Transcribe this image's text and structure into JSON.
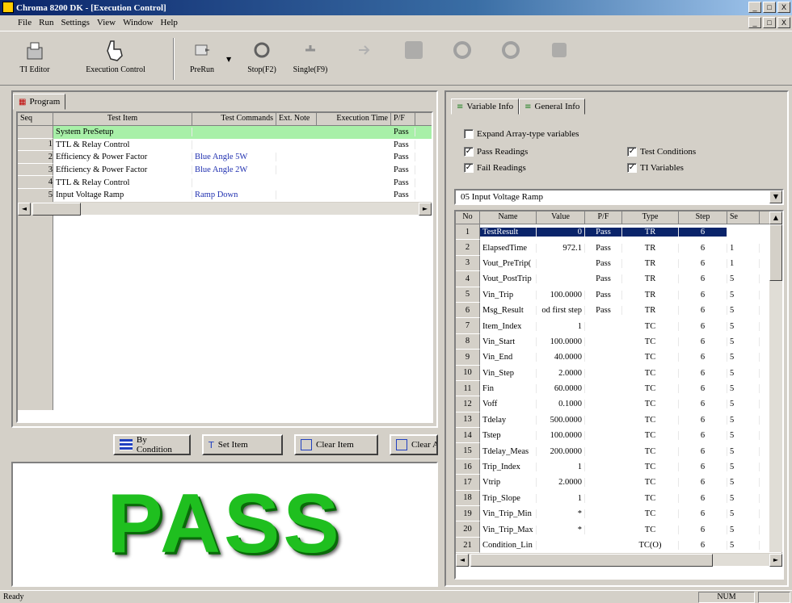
{
  "window": {
    "title": "Chroma 8200 DK - [Execution Control]",
    "controls": [
      "_",
      "□",
      "X"
    ],
    "mdi_controls": [
      "_",
      "□",
      "X"
    ]
  },
  "menu": [
    "File",
    "Run",
    "Settings",
    "View",
    "Window",
    "Help"
  ],
  "toolbar": {
    "ti_editor": "TI Editor",
    "execution_control": "Execution Control",
    "prerun": "PreRun",
    "stop": "Stop(F2)",
    "single": "Single(F9)"
  },
  "program_panel": {
    "tab": "Program",
    "columns": [
      "Seq",
      "Test Item",
      "Test Commands",
      "Ext. Note",
      "Execution Time",
      "P/F"
    ],
    "rows": [
      {
        "seq": "",
        "item": "System PreSetup",
        "cmd": "",
        "pf": "Pass"
      },
      {
        "seq": "1",
        "item": "TTL & Relay Control",
        "cmd": "",
        "pf": "Pass"
      },
      {
        "seq": "2",
        "item": "Efficiency & Power Factor",
        "cmd": "Blue Angle 5W",
        "pf": "Pass"
      },
      {
        "seq": "3",
        "item": "Efficiency & Power Factor",
        "cmd": "Blue Angle 2W",
        "pf": "Pass"
      },
      {
        "seq": "4",
        "item": "TTL & Relay Control",
        "cmd": "",
        "pf": "Pass"
      },
      {
        "seq": "5",
        "item": "Input Voltage Ramp",
        "cmd": "Ramp Down",
        "pf": "Pass"
      }
    ]
  },
  "buttons": {
    "by_condition": "By Condition",
    "set_item": "Set Item",
    "clear_item": "Clear Item",
    "clear_all": "Clear All"
  },
  "result": {
    "text": "PASS",
    "color": "#1fbf1f"
  },
  "variable_panel": {
    "tab_variable": "Variable Info",
    "tab_general": "General Info",
    "expand_array": "Expand Array-type variables",
    "pass_readings": "Pass Readings",
    "fail_readings": "Fail Readings",
    "test_conditions": "Test Conditions",
    "ti_variables": "TI Variables",
    "dropdown": "05 Input Voltage Ramp",
    "columns": [
      "No",
      "Name",
      "Value",
      "P/F",
      "Type",
      "Step",
      "Se"
    ],
    "rows": [
      {
        "no": "1",
        "name": "TestResult",
        "value": "0",
        "pf": "Pass",
        "type": "TR",
        "step": "6",
        "se": ""
      },
      {
        "no": "2",
        "name": "ElapsedTime",
        "value": "972.1",
        "pf": "Pass",
        "type": "TR",
        "step": "6",
        "se": "1"
      },
      {
        "no": "3",
        "name": "Vout_PreTrip(",
        "value": "",
        "pf": "Pass",
        "type": "TR",
        "step": "6",
        "se": "1"
      },
      {
        "no": "4",
        "name": "Vout_PostTrip",
        "value": "",
        "pf": "Pass",
        "type": "TR",
        "step": "6",
        "se": "5"
      },
      {
        "no": "5",
        "name": "Vin_Trip",
        "value": "100.0000",
        "pf": "Pass",
        "type": "TR",
        "step": "6",
        "se": "5"
      },
      {
        "no": "6",
        "name": "Msg_Result",
        "value": "od first step",
        "pf": "Pass",
        "type": "TR",
        "step": "6",
        "se": "5"
      },
      {
        "no": "7",
        "name": "Item_Index",
        "value": "1",
        "pf": "",
        "type": "TC",
        "step": "6",
        "se": "5"
      },
      {
        "no": "8",
        "name": "Vin_Start",
        "value": "100.0000",
        "pf": "",
        "type": "TC",
        "step": "6",
        "se": "5"
      },
      {
        "no": "9",
        "name": "Vin_End",
        "value": "40.0000",
        "pf": "",
        "type": "TC",
        "step": "6",
        "se": "5"
      },
      {
        "no": "10",
        "name": "Vin_Step",
        "value": "2.0000",
        "pf": "",
        "type": "TC",
        "step": "6",
        "se": "5"
      },
      {
        "no": "11",
        "name": "Fin",
        "value": "60.0000",
        "pf": "",
        "type": "TC",
        "step": "6",
        "se": "5"
      },
      {
        "no": "12",
        "name": "Voff",
        "value": "0.1000",
        "pf": "",
        "type": "TC",
        "step": "6",
        "se": "5"
      },
      {
        "no": "13",
        "name": "Tdelay",
        "value": "500.0000",
        "pf": "",
        "type": "TC",
        "step": "6",
        "se": "5"
      },
      {
        "no": "14",
        "name": "Tstep",
        "value": "100.0000",
        "pf": "",
        "type": "TC",
        "step": "6",
        "se": "5"
      },
      {
        "no": "15",
        "name": "Tdelay_Meas",
        "value": "200.0000",
        "pf": "",
        "type": "TC",
        "step": "6",
        "se": "5"
      },
      {
        "no": "16",
        "name": "Trip_Index",
        "value": "1",
        "pf": "",
        "type": "TC",
        "step": "6",
        "se": "5"
      },
      {
        "no": "17",
        "name": "Vtrip",
        "value": "2.0000",
        "pf": "",
        "type": "TC",
        "step": "6",
        "se": "5"
      },
      {
        "no": "18",
        "name": "Trip_Slope",
        "value": "1",
        "pf": "",
        "type": "TC",
        "step": "6",
        "se": "5"
      },
      {
        "no": "19",
        "name": "Vin_Trip_Min",
        "value": "*",
        "pf": "",
        "type": "TC",
        "step": "6",
        "se": "5"
      },
      {
        "no": "20",
        "name": "Vin_Trip_Max",
        "value": "*",
        "pf": "",
        "type": "TC",
        "step": "6",
        "se": "5"
      },
      {
        "no": "21",
        "name": "Condition_Lin",
        "value": "",
        "pf": "",
        "type": "TC(O)",
        "step": "6",
        "se": "5"
      }
    ]
  },
  "status": {
    "left": "Ready",
    "right": "NUM"
  }
}
